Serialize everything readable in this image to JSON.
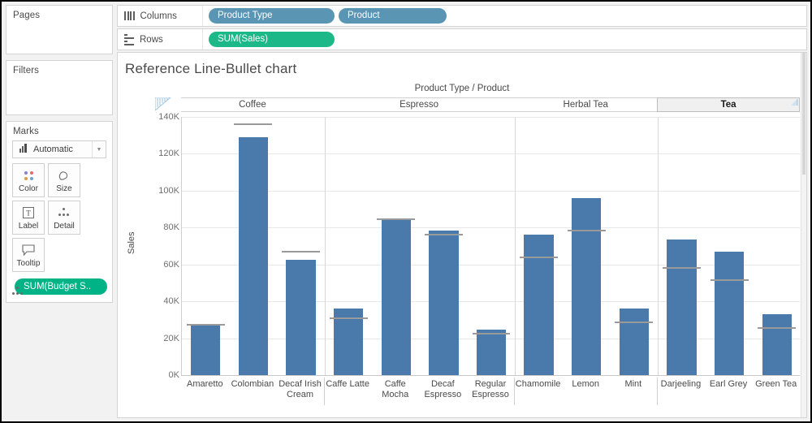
{
  "sidebar": {
    "pages_label": "Pages",
    "filters_label": "Filters",
    "marks_label": "Marks",
    "mark_type": "Automatic",
    "buttons": [
      {
        "label": "Color",
        "icon": "color-palette-icon"
      },
      {
        "label": "Size",
        "icon": "size-icon"
      },
      {
        "label": "Label",
        "icon": "label-icon"
      },
      {
        "label": "Detail",
        "icon": "detail-icon"
      },
      {
        "label": "Tooltip",
        "icon": "tooltip-icon"
      }
    ],
    "marks_pill": "SUM(Budget S..",
    "marks_pill_icon": "detail-icon"
  },
  "shelves": {
    "columns_label": "Columns",
    "columns_icon": "columns-icon",
    "columns_pills": [
      "Product Type",
      "Product"
    ],
    "rows_label": "Rows",
    "rows_icon": "rows-icon",
    "rows_pills": [
      "SUM(Sales)"
    ]
  },
  "viz": {
    "title": "Reference Line-Bullet chart",
    "column_caption": "Product Type / Product",
    "selected_group": "Tea"
  },
  "colors": {
    "bar": "#4a7aab",
    "reference_line": "#9a9a9a",
    "dimension_pill": "#5a95b4",
    "measure_pill": "#1db887",
    "marks_pill": "#00b386"
  },
  "chart_data": {
    "type": "bar",
    "title": "Reference Line-Bullet chart",
    "xlabel": "Product Type / Product",
    "ylabel": "Sales",
    "ylim": [
      0,
      140000
    ],
    "yticks": [
      "0K",
      "20K",
      "40K",
      "60K",
      "80K",
      "100K",
      "120K",
      "140K"
    ],
    "ytick_values": [
      0,
      20000,
      40000,
      60000,
      80000,
      100000,
      120000,
      140000
    ],
    "grid": true,
    "legend": "none",
    "groups": [
      {
        "name": "Coffee",
        "categories": [
          "Amaretto",
          "Colombian",
          "Decaf Irish Cream"
        ]
      },
      {
        "name": "Espresso",
        "categories": [
          "Caffe Latte",
          "Caffe Mocha",
          "Decaf Espresso",
          "Regular Espresso"
        ]
      },
      {
        "name": "Herbal Tea",
        "categories": [
          "Chamomile",
          "Lemon",
          "Mint"
        ]
      },
      {
        "name": "Tea",
        "categories": [
          "Darjeeling",
          "Earl Grey",
          "Green Tea"
        ]
      }
    ],
    "categories": [
      "Amaretto",
      "Colombian",
      "Decaf Irish Cream",
      "Caffe Latte",
      "Caffe Mocha",
      "Decaf Espresso",
      "Regular Espresso",
      "Chamomile",
      "Lemon",
      "Mint",
      "Darjeeling",
      "Earl Grey",
      "Green Tea"
    ],
    "series": [
      {
        "name": "SUM(Sales)",
        "type": "bar",
        "values": [
          27000,
          129000,
          62500,
          36000,
          85000,
          78500,
          24500,
          76000,
          96000,
          36000,
          73500,
          67000,
          33000
        ]
      },
      {
        "name": "SUM(Budget Sales)",
        "type": "reference-line",
        "values": [
          27500,
          136000,
          67000,
          31000,
          84500,
          76000,
          22500,
          64000,
          78500,
          28500,
          58000,
          51500,
          25500
        ]
      }
    ]
  }
}
